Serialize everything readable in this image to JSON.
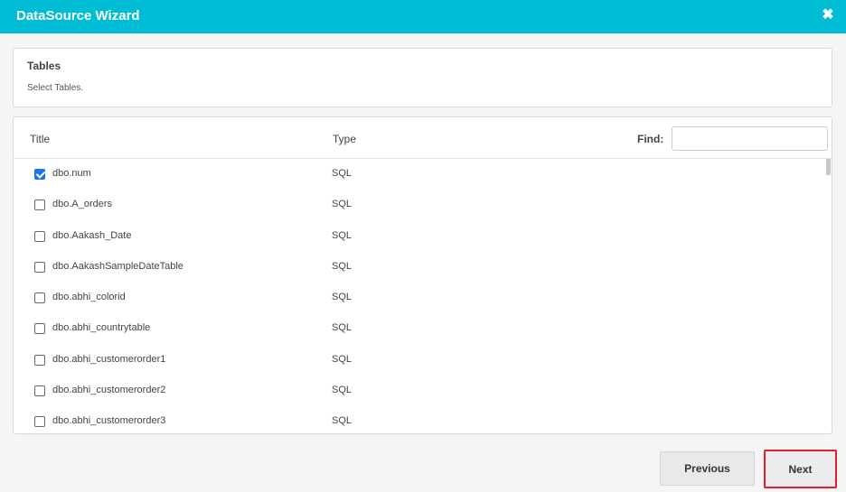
{
  "dialog": {
    "title": "DataSource Wizard",
    "close_glyph": "✖"
  },
  "section": {
    "title": "Tables",
    "subtitle": "Select Tables."
  },
  "grid": {
    "columns": {
      "title": "Title",
      "type": "Type"
    },
    "find_label": "Find:",
    "find_value": "",
    "rows": [
      {
        "name": "dbo.num",
        "type": "SQL",
        "checked": true
      },
      {
        "name": "dbo.A_orders",
        "type": "SQL",
        "checked": false
      },
      {
        "name": "dbo.Aakash_Date",
        "type": "SQL",
        "checked": false
      },
      {
        "name": "dbo.AakashSampleDateTable",
        "type": "SQL",
        "checked": false
      },
      {
        "name": "dbo.abhi_colorid",
        "type": "SQL",
        "checked": false
      },
      {
        "name": "dbo.abhi_countrytable",
        "type": "SQL",
        "checked": false
      },
      {
        "name": "dbo.abhi_customerorder1",
        "type": "SQL",
        "checked": false
      },
      {
        "name": "dbo.abhi_customerorder2",
        "type": "SQL",
        "checked": false
      },
      {
        "name": "dbo.abhi_customerorder3",
        "type": "SQL",
        "checked": false
      }
    ]
  },
  "footer": {
    "previous_label": "Previous",
    "next_label": "Next"
  },
  "colors": {
    "titlebar": "#00bcd4",
    "checkbox_checked": "#1e73e8",
    "highlight": "#e0202a"
  }
}
